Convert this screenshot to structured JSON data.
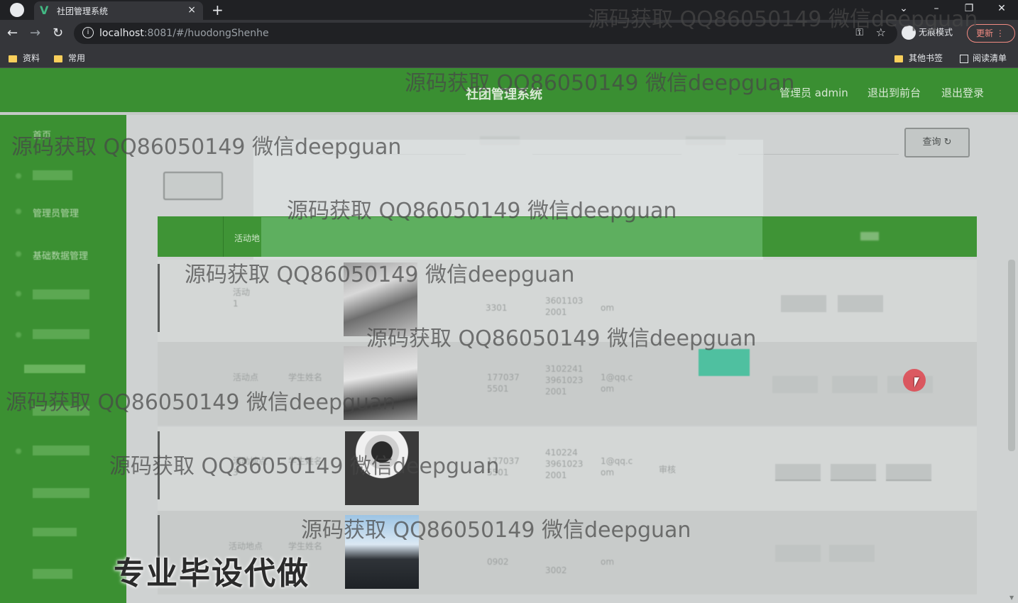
{
  "browser": {
    "tab_title": "社团管理系统",
    "tab_close": "×",
    "new_tab": "+",
    "window_controls": [
      "⌄",
      "–",
      "❐",
      "✕"
    ],
    "url_host": "localhost",
    "url_rest": ":8081/#/huodongShenhe",
    "incognito_label": "无痕模式",
    "update_label": "更新",
    "bookmarks": [
      "资料",
      "常用"
    ],
    "other_bookmarks": "其他书签",
    "reading_list": "阅读清单"
  },
  "header": {
    "title": "社团管理系统",
    "admin": "管理员 admin",
    "to_front": "退出到前台",
    "logout": "退出登录"
  },
  "sidebar": {
    "items": [
      "首页",
      "",
      "管理员管理",
      "基础数据管理",
      "",
      "",
      "",
      "",
      "",
      "",
      "",
      ""
    ]
  },
  "search": {
    "query_button": "查询"
  },
  "table": {
    "header_visible": "活动地"
  },
  "rows": [
    {
      "c1": "活动",
      "c1b": "1",
      "c2": "",
      "phone": "",
      "phone2": "3301",
      "id": "3601103",
      "id2": "2001",
      "email": "",
      "email2": "om",
      "status": "",
      "status2": "",
      "ops": [
        "",
        "",
        ""
      ]
    },
    {
      "c1": "活动点",
      "c1b": "",
      "c2": "学生姓名",
      "phone": "177037",
      "phone2": "5501",
      "id": "3102241",
      "id2": "3961023",
      "id3": "2001",
      "email": "1@qq.c",
      "email2": "om",
      "status": "",
      "status2": "",
      "ops": [
        "",
        "",
        ""
      ]
    },
    {
      "c1": "活动地点",
      "c1b": "3",
      "c2": "学生姓名",
      "phone": "177037",
      "phone2": "5501",
      "id": "410224",
      "id2": "3961023",
      "id3": "2001",
      "email": "1@qq.c",
      "email2": "om",
      "status": "审核",
      "status2": "",
      "ops": [
        "",
        "",
        ""
      ]
    },
    {
      "c1": "活动地点",
      "c1b": "",
      "c2": "学生姓名",
      "phone": "",
      "phone2": "0902",
      "id": "",
      "id2": "",
      "id3": "3002",
      "email": "",
      "email2": "om",
      "status": "",
      "status2": "",
      "ops": [
        "",
        "",
        ""
      ]
    }
  ],
  "watermark": "源码获取 QQ86050149 微信deepguan",
  "promo": "专业毕设代做"
}
